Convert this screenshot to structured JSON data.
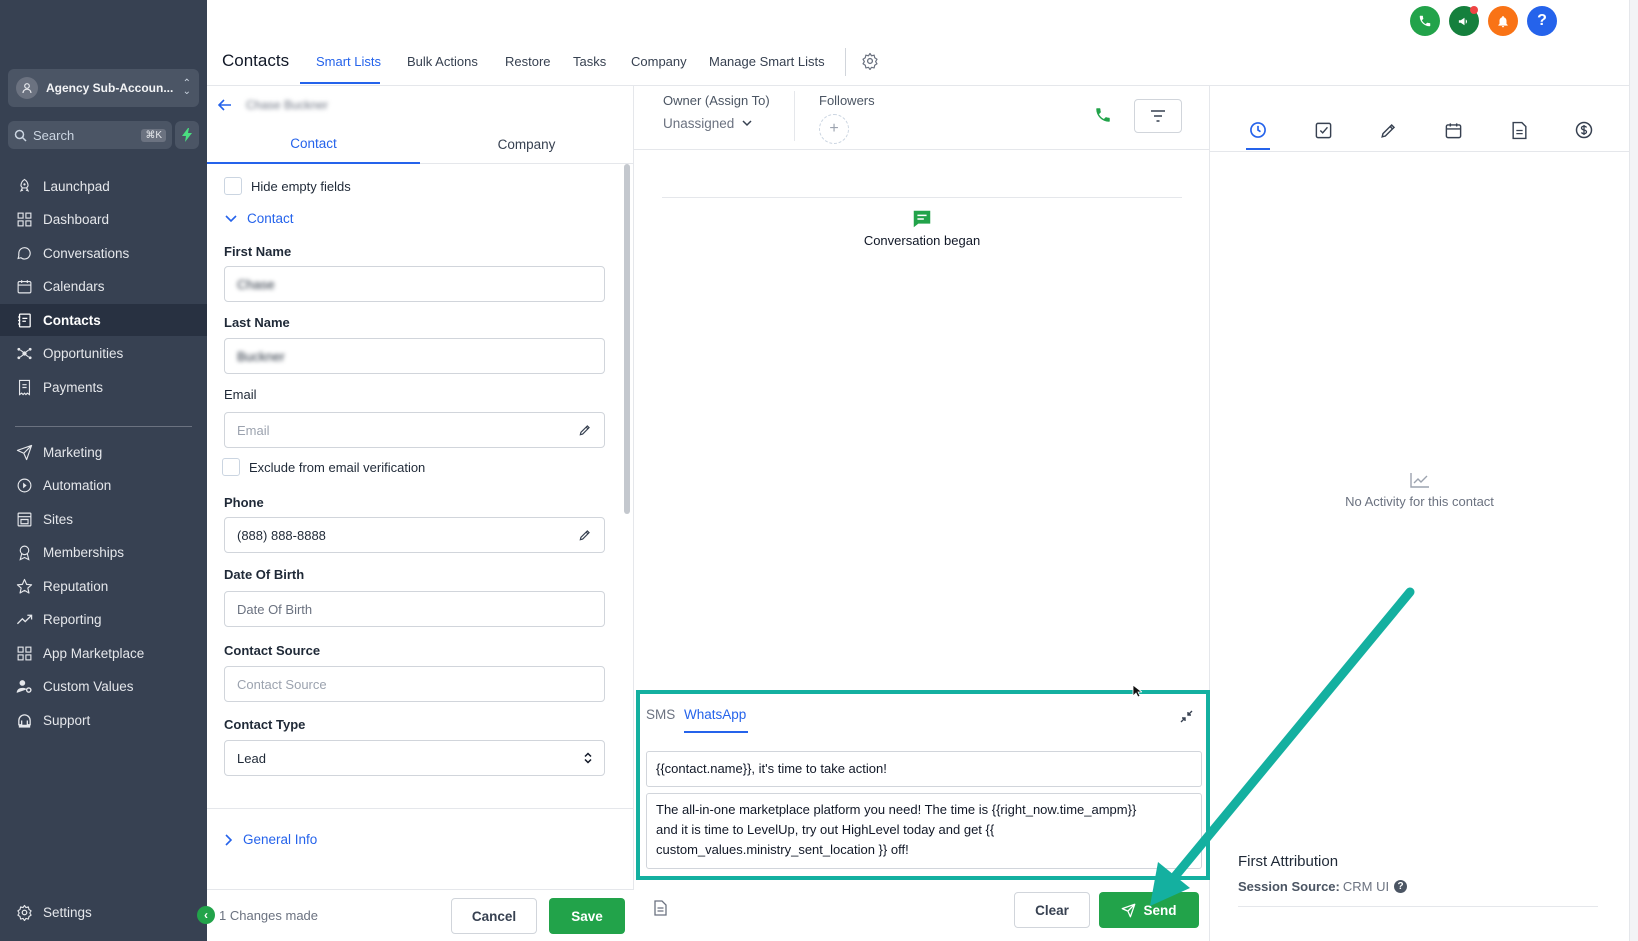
{
  "sidebar": {
    "account_name": "Agency Sub-Accoun...",
    "search_label": "Search",
    "search_shortcut": "⌘K",
    "items": [
      {
        "label": "Launchpad",
        "icon": "rocket-icon"
      },
      {
        "label": "Dashboard",
        "icon": "grid-icon"
      },
      {
        "label": "Conversations",
        "icon": "chat-icon"
      },
      {
        "label": "Calendars",
        "icon": "calendar-icon"
      },
      {
        "label": "Contacts",
        "icon": "contacts-icon",
        "active": true
      },
      {
        "label": "Opportunities",
        "icon": "network-icon"
      },
      {
        "label": "Payments",
        "icon": "receipt-icon"
      }
    ],
    "items2": [
      {
        "label": "Marketing",
        "icon": "send-icon"
      },
      {
        "label": "Automation",
        "icon": "automation-icon"
      },
      {
        "label": "Sites",
        "icon": "sites-icon"
      },
      {
        "label": "Memberships",
        "icon": "membership-icon"
      },
      {
        "label": "Reputation",
        "icon": "star-icon"
      },
      {
        "label": "Reporting",
        "icon": "trend-icon"
      },
      {
        "label": "App Marketplace",
        "icon": "apps-icon"
      },
      {
        "label": "Custom Values",
        "icon": "users-gear-icon"
      },
      {
        "label": "Support",
        "icon": "support-icon"
      }
    ],
    "settings_label": "Settings"
  },
  "topnav": {
    "title": "Contacts",
    "tabs": [
      "Smart Lists",
      "Bulk Actions",
      "Restore",
      "Tasks",
      "Company",
      "Manage Smart Lists"
    ],
    "active_tab": "Smart Lists"
  },
  "top_icons": {
    "phone_color": "#22a34a",
    "megaphone_color": "#15803d",
    "bell_color": "#f97316",
    "help_color": "#2563eb",
    "help_label": "?"
  },
  "contact_panel": {
    "contact_name": "Chase Buckner",
    "tabs": [
      "Contact",
      "Company"
    ],
    "hide_empty_label": "Hide empty fields",
    "section_label": "Contact",
    "first_name_label": "First Name",
    "first_name_value": "Chase",
    "last_name_label": "Last Name",
    "last_name_value": "Buckner",
    "email_label": "Email",
    "email_placeholder": "Email",
    "exclude_label": "Exclude from email verification",
    "phone_label": "Phone",
    "phone_value": "(888) 888-8888",
    "dob_label": "Date Of Birth",
    "dob_placeholder": "Date Of Birth",
    "source_label": "Contact Source",
    "source_placeholder": "Contact Source",
    "type_label": "Contact Type",
    "type_value": "Lead",
    "general_info_label": "General Info",
    "changes_text": "1 Changes made",
    "cancel_label": "Cancel",
    "save_label": "Save"
  },
  "conversation": {
    "owner_label": "Owner (Assign To)",
    "owner_value": "Unassigned",
    "followers_label": "Followers",
    "conversation_began": "Conversation began",
    "composer_tabs": [
      "SMS",
      "WhatsApp"
    ],
    "active_composer_tab": "WhatsApp",
    "message_line": "{{contact.name}}, it's time to take action!",
    "message_body_lines": [
      "The all-in-one marketplace platform you need! The time is {{right_now.time_ampm}}",
      "and it is time to LevelUp, try out HighLevel today and get {{",
      "custom_values.ministry_sent_location }} off!"
    ],
    "clear_label": "Clear",
    "send_label": "Send"
  },
  "activity": {
    "no_activity": "No Activity for this contact",
    "attribution_title": "First Attribution",
    "session_source_label": "Session Source:",
    "session_source_value": "CRM UI"
  },
  "colors": {
    "sidebar_bg": "#374152",
    "accent_blue": "#2563eb",
    "success_green": "#22a34a",
    "highlight_teal": "#14b0a0"
  }
}
